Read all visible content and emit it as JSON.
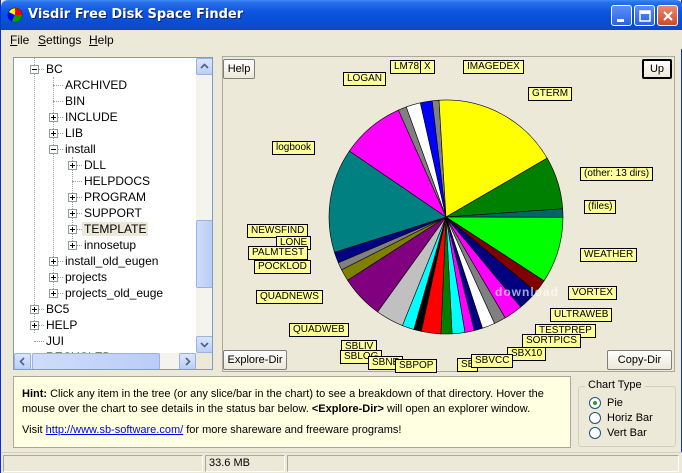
{
  "window": {
    "title": "Visdir Free Disk Space Finder"
  },
  "menu": [
    {
      "key": "F",
      "rest": "ile"
    },
    {
      "key": "S",
      "rest": "ettings"
    },
    {
      "key": "H",
      "rest": "elp"
    }
  ],
  "tree": {
    "items": [
      {
        "label": "BC",
        "expander": "minus"
      },
      {
        "label": "ARCHIVED",
        "expander": "none"
      },
      {
        "label": "BIN",
        "expander": "none"
      },
      {
        "label": "INCLUDE",
        "expander": "plus"
      },
      {
        "label": "LIB",
        "expander": "plus"
      },
      {
        "label": "install",
        "expander": "minus"
      },
      {
        "label": "DLL",
        "expander": "plus"
      },
      {
        "label": "HELPDOCS",
        "expander": "none"
      },
      {
        "label": "PROGRAM",
        "expander": "plus"
      },
      {
        "label": "SUPPORT",
        "expander": "plus"
      },
      {
        "label": "TEMPLATE",
        "expander": "plus",
        "selected": true
      },
      {
        "label": "innosetup",
        "expander": "plus"
      },
      {
        "label": "install_old_eugen",
        "expander": "plus"
      },
      {
        "label": "projects",
        "expander": "plus"
      },
      {
        "label": "projects_old_euge",
        "expander": "plus"
      },
      {
        "label": "BC5",
        "expander": "plus"
      },
      {
        "label": "HELP",
        "expander": "plus"
      },
      {
        "label": "JUI",
        "expander": "none"
      },
      {
        "label": "RECYCLED",
        "expander": "none"
      }
    ]
  },
  "buttons": {
    "help": "Help",
    "up": "Up",
    "explore": "Explore-Dir",
    "copy": "Copy-Dir"
  },
  "chart_data": {
    "type": "pie",
    "slices": [
      {
        "label": "LOGAN",
        "value": 1.0,
        "color": "#808080"
      },
      {
        "label": "LM78",
        "value": 1.7,
        "color": "#ffffff"
      },
      {
        "label": "X",
        "value": 1.4,
        "color": "#0000ff"
      },
      {
        "label": "IMAGEDEX",
        "value": 0.8,
        "color": "#808080"
      },
      {
        "label": "GTERM",
        "value": 15.0,
        "color": "#ffff00"
      },
      {
        "label": "(other: 13 dirs)",
        "value": 6.2,
        "color": "#008000"
      },
      {
        "label": "(files)",
        "value": 1.0,
        "color": "#006666"
      },
      {
        "label": "WEATHER",
        "value": 7.8,
        "color": "#00ff00"
      },
      {
        "label": "VORTEX",
        "value": 1.6,
        "color": "#800000"
      },
      {
        "label": "ULTRAWEB",
        "value": 2.5,
        "color": "#000080"
      },
      {
        "label": "TESTPREP",
        "value": 2.2,
        "color": "#ff00ff"
      },
      {
        "label": "SORTPICS",
        "value": 1.4,
        "color": "#808080"
      },
      {
        "label": "SBX10",
        "value": 1.5,
        "color": "#ffffff"
      },
      {
        "label": "SBVCC",
        "value": 1.0,
        "color": "#000080"
      },
      {
        "label": "SB...",
        "value": 1.1,
        "color": "#ff00ff"
      },
      {
        "label": "SBPOP",
        "value": 1.5,
        "color": "#00ffff"
      },
      {
        "label": "SBNE...",
        "value": 1.3,
        "color": "#008000"
      },
      {
        "label": "SBLOG",
        "value": 2.3,
        "color": "#ff0000"
      },
      {
        "label": "SBLIV...",
        "value": 0.9,
        "color": "#000000"
      },
      {
        "label": "QUADWEB",
        "value": 1.4,
        "color": "#00ffff"
      },
      {
        "label": "QUADNEWS",
        "value": 3.3,
        "color": "#c0c0c0"
      },
      {
        "label": "POCKLOD",
        "value": 5.1,
        "color": "#800080"
      },
      {
        "label": "PALMTEST",
        "value": 1.4,
        "color": "#808000"
      },
      {
        "label": "LONE",
        "value": 0.9,
        "color": "#808080"
      },
      {
        "label": "NEWSFIND",
        "value": 1.3,
        "color": "#000080"
      },
      {
        "label": "logbook",
        "value": 12.3,
        "color": "#008080"
      },
      {
        "label": "LOGAN",
        "value": 7.5,
        "color": "#ff00ff"
      }
    ],
    "labels": [
      {
        "text": "LOGAN"
      },
      {
        "text": "LM78"
      },
      {
        "text": "X"
      },
      {
        "text": "IMAGEDEX"
      },
      {
        "text": "GTERM"
      },
      {
        "text": "logbook"
      },
      {
        "text": "(other: 13 dirs)"
      },
      {
        "text": "(files)"
      },
      {
        "text": "NEWSFIND"
      },
      {
        "text": "LONE"
      },
      {
        "text": "PALMTEST"
      },
      {
        "text": "WEATHER"
      },
      {
        "text": "POCKLOD"
      },
      {
        "text": "QUADNEWS"
      },
      {
        "text": "VORTEX"
      },
      {
        "text": "ULTRAWEB"
      },
      {
        "text": "QUADWEB"
      },
      {
        "text": "TESTPREP"
      },
      {
        "text": "SORTPICS"
      },
      {
        "text": "SBLIV"
      },
      {
        "text": "SBX10"
      },
      {
        "text": "SBLOG"
      },
      {
        "text": "SBNE"
      },
      {
        "text": "SBPOP"
      },
      {
        "text": "SB"
      },
      {
        "text": "SBVCC"
      }
    ]
  },
  "watermark": "download",
  "hint": {
    "bold": "Hint:",
    "text1": " Click any item in the tree (or any slice/bar in the chart) to see a breakdown of that directory. Hover the mouse over the chart to see details in the status bar below. ",
    "bold2": "<Explore-Dir>",
    "text2": " will open an explorer window.",
    "visit": "Visit ",
    "link": "http://www.sb-software.com/",
    "after": " for more shareware and freeware programs!"
  },
  "chart_type": {
    "title": "Chart Type",
    "options": [
      {
        "label": "Pie",
        "selected": true
      },
      {
        "label": "Horiz Bar",
        "selected": false
      },
      {
        "label": "Vert Bar",
        "selected": false
      }
    ]
  },
  "status": {
    "panel1": "",
    "size": "33.6 MB",
    "panel3": ""
  },
  "colors": {
    "titlebar": "#0b55e0",
    "label_bg": "#ffff99",
    "hint_bg": "#ffffe1"
  }
}
